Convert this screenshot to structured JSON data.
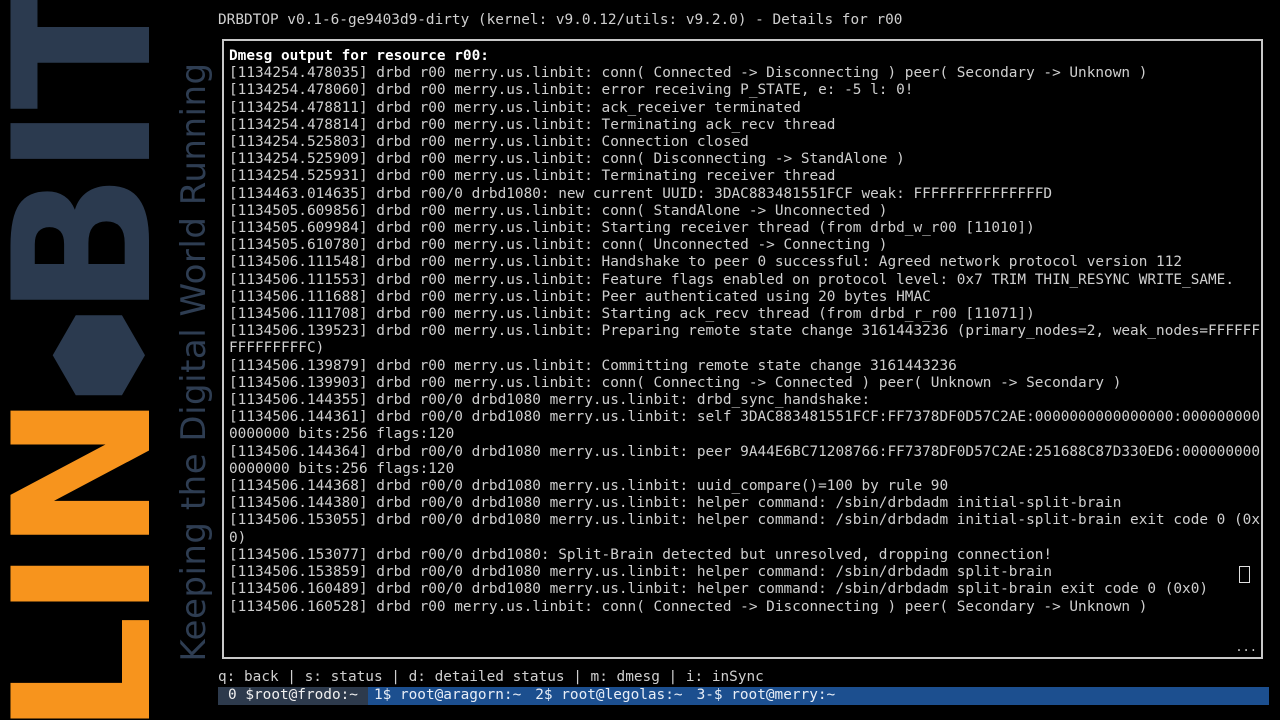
{
  "branding": {
    "logo_text_left": "LIN",
    "logo_text_right": "BIT",
    "tagline": "Keeping the Digital World Running",
    "colors": {
      "orange": "#f7941d",
      "navy": "#2b3a4f"
    }
  },
  "window_title": "DRBDTOP v0.1-6-ge9403d9-dirty (kernel: v9.0.12/utils: v9.2.0) - Details for r00",
  "panel": {
    "heading": "Dmesg output for resource r00:",
    "lines": [
      "[1134254.478035] drbd r00 merry.us.linbit: conn( Connected -> Disconnecting ) peer( Secondary -> Unknown )",
      "[1134254.478060] drbd r00 merry.us.linbit: error receiving P_STATE, e: -5 l: 0!",
      "[1134254.478811] drbd r00 merry.us.linbit: ack_receiver terminated",
      "[1134254.478814] drbd r00 merry.us.linbit: Terminating ack_recv thread",
      "[1134254.525803] drbd r00 merry.us.linbit: Connection closed",
      "[1134254.525909] drbd r00 merry.us.linbit: conn( Disconnecting -> StandAlone )",
      "[1134254.525931] drbd r00 merry.us.linbit: Terminating receiver thread",
      "[1134463.014635] drbd r00/0 drbd1080: new current UUID: 3DAC883481551FCF weak: FFFFFFFFFFFFFFFD",
      "[1134505.609856] drbd r00 merry.us.linbit: conn( StandAlone -> Unconnected )",
      "[1134505.609984] drbd r00 merry.us.linbit: Starting receiver thread (from drbd_w_r00 [11010])",
      "[1134505.610780] drbd r00 merry.us.linbit: conn( Unconnected -> Connecting )",
      "[1134506.111548] drbd r00 merry.us.linbit: Handshake to peer 0 successful: Agreed network protocol version 112",
      "[1134506.111553] drbd r00 merry.us.linbit: Feature flags enabled on protocol level: 0x7 TRIM THIN_RESYNC WRITE_SAME.",
      "[1134506.111688] drbd r00 merry.us.linbit: Peer authenticated using 20 bytes HMAC",
      "[1134506.111708] drbd r00 merry.us.linbit: Starting ack_recv thread (from drbd_r_r00 [11071])",
      "[1134506.139523] drbd r00 merry.us.linbit: Preparing remote state change 3161443236 (primary_nodes=2, weak_nodes=FFFFFFFFFFFFFFFC)",
      "[1134506.139879] drbd r00 merry.us.linbit: Committing remote state change 3161443236",
      "[1134506.139903] drbd r00 merry.us.linbit: conn( Connecting -> Connected ) peer( Unknown -> Secondary )",
      "[1134506.144355] drbd r00/0 drbd1080 merry.us.linbit: drbd_sync_handshake:",
      "[1134506.144361] drbd r00/0 drbd1080 merry.us.linbit: self 3DAC883481551FCF:FF7378DF0D57C2AE:0000000000000000:0000000000000000 bits:256 flags:120",
      "[1134506.144364] drbd r00/0 drbd1080 merry.us.linbit: peer 9A44E6BC71208766:FF7378DF0D57C2AE:251688C87D330ED6:0000000000000000 bits:256 flags:120",
      "[1134506.144368] drbd r00/0 drbd1080 merry.us.linbit: uuid_compare()=100 by rule 90",
      "[1134506.144380] drbd r00/0 drbd1080 merry.us.linbit: helper command: /sbin/drbdadm initial-split-brain",
      "[1134506.153055] drbd r00/0 drbd1080 merry.us.linbit: helper command: /sbin/drbdadm initial-split-brain exit code 0 (0x0)",
      "[1134506.153077] drbd r00/0 drbd1080: Split-Brain detected but unresolved, dropping connection!",
      "[1134506.153859] drbd r00/0 drbd1080 merry.us.linbit: helper command: /sbin/drbdadm split-brain",
      "[1134506.160489] drbd r00/0 drbd1080 merry.us.linbit: helper command: /sbin/drbdadm split-brain exit code 0 (0x0)",
      "[1134506.160528] drbd r00 merry.us.linbit: conn( Connected -> Disconnecting ) peer( Secondary -> Unknown )"
    ],
    "scroll_indicator": "..."
  },
  "helpbar": "q: back | s: status | d: detailed status | m: dmesg | i: inSync",
  "tmux": {
    "windows": [
      {
        "label": "0 $root@frodo:~",
        "active": true
      },
      {
        "label": "1$ root@aragorn:~",
        "active": false
      },
      {
        "label": "2$ root@legolas:~",
        "active": false
      },
      {
        "label": "3-$ root@merry:~",
        "active": false
      }
    ],
    "colors": {
      "bar": "#1c4f8f",
      "active": "#2d3a4c"
    }
  }
}
